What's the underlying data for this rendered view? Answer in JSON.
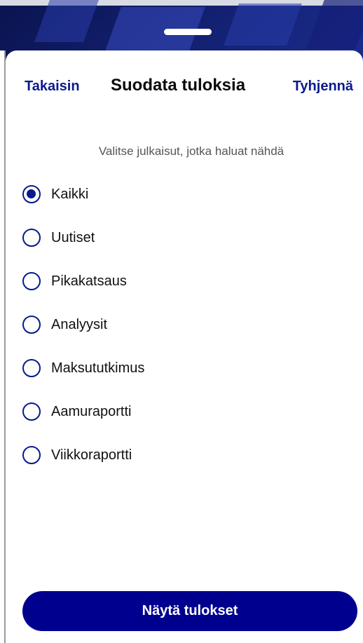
{
  "header": {
    "back_label": "Takaisin",
    "title": "Suodata tuloksia",
    "clear_label": "Tyhjennä"
  },
  "instruction": "Valitse julkaisut, jotka haluat nähdä",
  "options": [
    {
      "label": "Kaikki",
      "selected": true
    },
    {
      "label": "Uutiset",
      "selected": false
    },
    {
      "label": "Pikakatsaus",
      "selected": false
    },
    {
      "label": "Analyysit",
      "selected": false
    },
    {
      "label": "Maksututkimus",
      "selected": false
    },
    {
      "label": "Aamuraportti",
      "selected": false
    },
    {
      "label": "Viikkoraportti",
      "selected": false
    }
  ],
  "footer": {
    "show_results_label": "Näytä tulokset"
  },
  "colors": {
    "accent": "#0a1a8c",
    "button_bg": "#00008f",
    "background_top": "#0d1d6b"
  }
}
